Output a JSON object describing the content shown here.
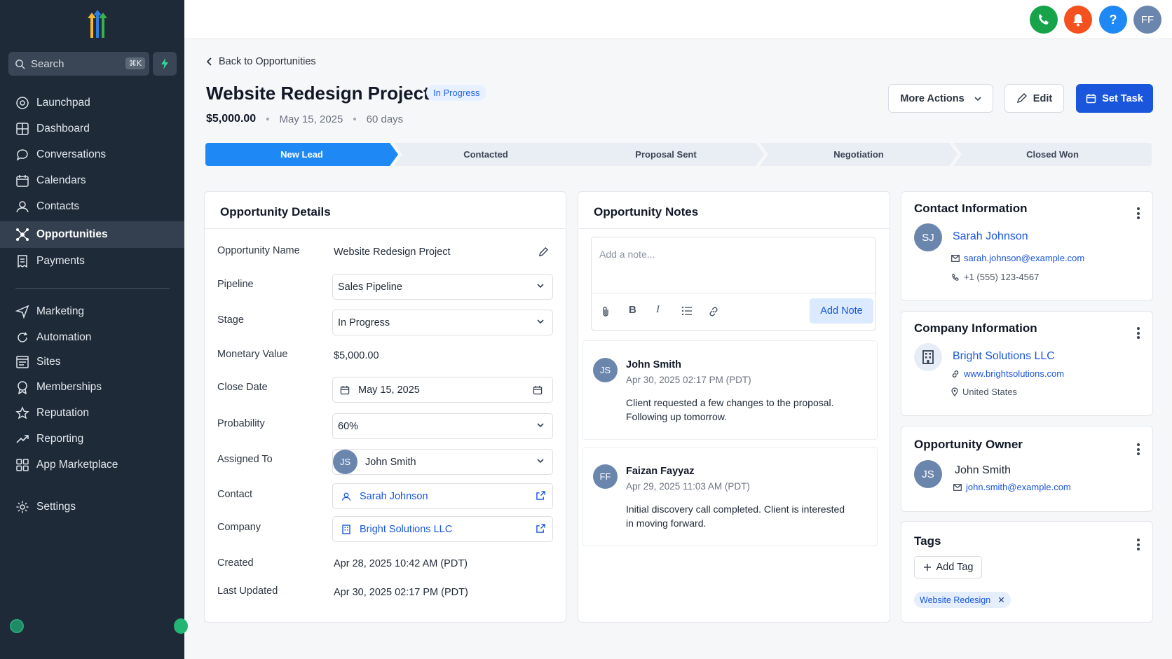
{
  "sidebar": {
    "search_placeholder": "Search",
    "search_shortcut": "⌘K",
    "items": [
      {
        "label": "Launchpad",
        "icon": "launchpad-icon"
      },
      {
        "label": "Dashboard",
        "icon": "dashboard-icon"
      },
      {
        "label": "Conversations",
        "icon": "chat-icon"
      },
      {
        "label": "Calendars",
        "icon": "calendar-icon"
      },
      {
        "label": "Contacts",
        "icon": "person-icon"
      },
      {
        "label": "Opportunities",
        "icon": "opportunities-icon",
        "active": true
      },
      {
        "label": "Payments",
        "icon": "receipt-icon"
      },
      {
        "label": "Marketing",
        "icon": "send-icon"
      },
      {
        "label": "Automation",
        "icon": "automation-icon"
      },
      {
        "label": "Sites",
        "icon": "sites-icon"
      },
      {
        "label": "Memberships",
        "icon": "award-icon"
      },
      {
        "label": "Reputation",
        "icon": "star-icon"
      },
      {
        "label": "Reporting",
        "icon": "trend-icon"
      },
      {
        "label": "App Marketplace",
        "icon": "grid-icon"
      },
      {
        "label": "Settings",
        "icon": "gear-icon"
      }
    ]
  },
  "topbar": {
    "user_initials": "FF",
    "help_label": "?"
  },
  "page": {
    "back_label": "Back to Opportunities",
    "title": "Website Redesign Project",
    "status": "In Progress",
    "amount": "$5,000.00",
    "date": "May 15, 2025",
    "duration": "60 days",
    "more_actions": "More Actions",
    "edit": "Edit",
    "set_task": "Set Task"
  },
  "stages": [
    "New Lead",
    "Contacted",
    "Proposal Sent",
    "Negotiation",
    "Closed Won"
  ],
  "details": {
    "title": "Opportunity Details",
    "labels": {
      "name": "Opportunity Name",
      "pipeline": "Pipeline",
      "stage": "Stage",
      "value": "Monetary Value",
      "close": "Close Date",
      "probability": "Probability",
      "assigned": "Assigned To",
      "contact": "Contact",
      "company": "Company",
      "created": "Created",
      "updated": "Last Updated"
    },
    "values": {
      "name": "Website Redesign Project",
      "pipeline": "Sales Pipeline",
      "stage": "In Progress",
      "value": "$5,000.00",
      "close": "May 15, 2025",
      "probability": "60%",
      "assigned_initials": "JS",
      "assigned": "John Smith",
      "contact": "Sarah Johnson",
      "company": "Bright Solutions LLC",
      "created": "Apr 28, 2025 10:42 AM (PDT)",
      "updated": "Apr 30, 2025 02:17 PM (PDT)"
    }
  },
  "notes": {
    "title": "Opportunity Notes",
    "placeholder": "Add a note...",
    "add_button": "Add Note",
    "items": [
      {
        "initials": "JS",
        "author": "John Smith",
        "time": "Apr 30, 2025 02:17 PM (PDT)",
        "body_line1": "Client requested a few changes to the proposal.",
        "body_line2": "Following up tomorrow."
      },
      {
        "initials": "FF",
        "author": "Faizan Fayyaz",
        "time": "Apr 29, 2025 11:03 AM (PDT)",
        "body_line1": "Initial discovery call completed. Client is interested",
        "body_line2": "in moving forward."
      }
    ]
  },
  "contact_card": {
    "title": "Contact Information",
    "initials": "SJ",
    "name": "Sarah Johnson",
    "email": "sarah.johnson@example.com",
    "phone": "+1 (555) 123-4567"
  },
  "company_card": {
    "title": "Company Information",
    "name": "Bright Solutions LLC",
    "website": "www.brightsolutions.com",
    "country": "United States"
  },
  "owner_card": {
    "title": "Opportunity Owner",
    "initials": "JS",
    "name": "John Smith",
    "email": "john.smith@example.com"
  },
  "tags_card": {
    "title": "Tags",
    "add_label": "Add Tag",
    "tags": [
      "Website Redesign"
    ]
  },
  "colors": {
    "sidebar_bg": "#1e2a38",
    "primary": "#1a56db",
    "stage_active": "#1e88f5",
    "phone_btn": "#16a34a",
    "bell_btn": "#f4511e",
    "help_btn": "#1e88f5",
    "avatar": "#6b86ad"
  }
}
